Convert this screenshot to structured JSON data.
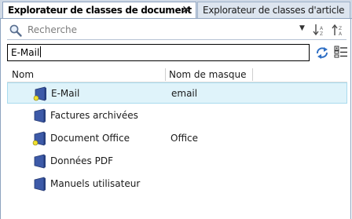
{
  "tabs": [
    {
      "label": "Explorateur de classes de document",
      "active": true
    },
    {
      "label": "Explorateur de classes d'article",
      "active": false
    }
  ],
  "toolbar": {
    "search_placeholder": "Recherche",
    "search_icon": "magnifier-icon",
    "sort_asc_icon": "sort-ascending-icon",
    "sort_desc_icon": "sort-descending-icon"
  },
  "filter": {
    "value": "E-Mail",
    "refresh_icon": "refresh-icon",
    "columns_icon": "column-chooser-icon"
  },
  "grid": {
    "columns": [
      "Nom",
      "Nom de masque"
    ],
    "rows": [
      {
        "name": "E-Mail",
        "mask": "email",
        "selected": true,
        "has_badge": true
      },
      {
        "name": "Factures archivées",
        "mask": "",
        "selected": false,
        "has_badge": false
      },
      {
        "name": "Document Office",
        "mask": "Office",
        "selected": false,
        "has_badge": true
      },
      {
        "name": "Données PDF",
        "mask": "",
        "selected": false,
        "has_badge": false
      },
      {
        "name": "Manuels utilisateur",
        "mask": "",
        "selected": false,
        "has_badge": false
      }
    ]
  },
  "colors": {
    "selection_bg": "#dff3fa",
    "folder_icon": "#3d5aa8",
    "badge": "#f0e030"
  }
}
